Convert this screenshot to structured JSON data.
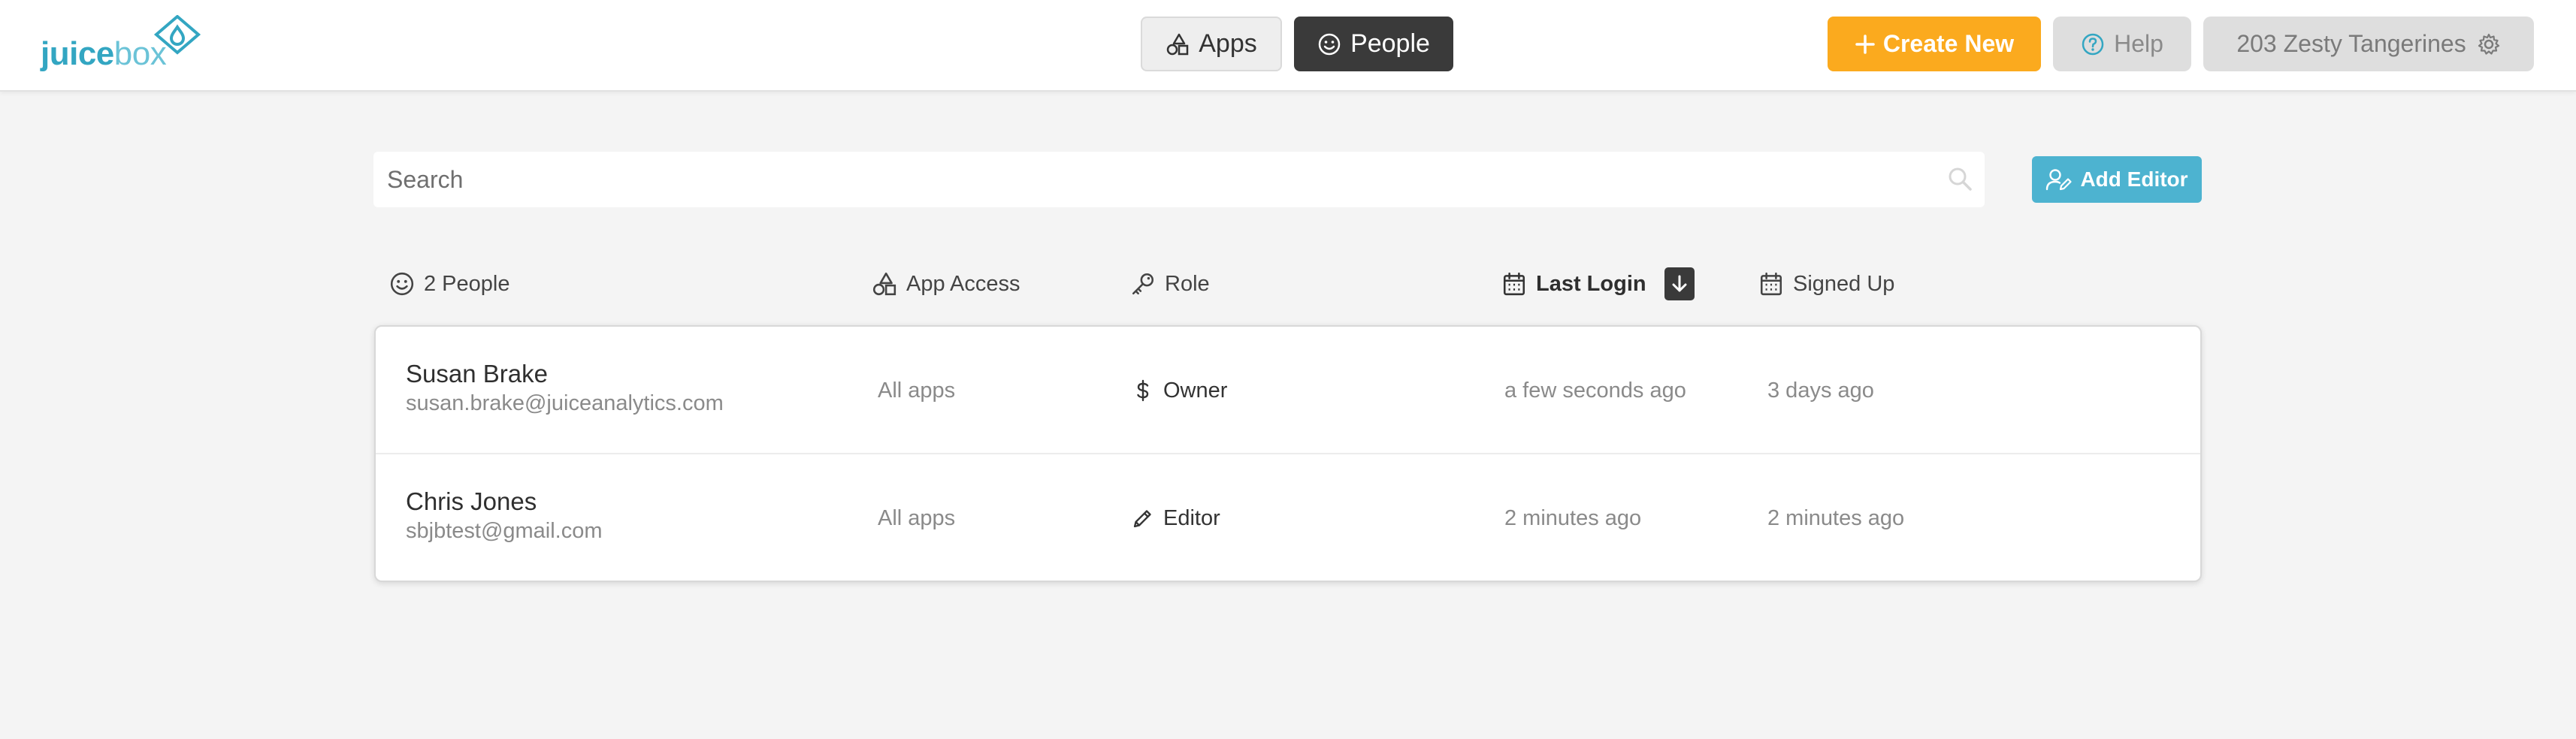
{
  "brand": {
    "part1": "juice",
    "part2": "box"
  },
  "nav": {
    "apps_label": "Apps",
    "people_label": "People"
  },
  "header": {
    "create_label": "Create New",
    "help_label": "Help",
    "team_label": "203 Zesty Tangerines"
  },
  "search": {
    "placeholder": "Search",
    "value": ""
  },
  "add_editor_label": "Add Editor",
  "columns": {
    "people": "2 People",
    "app_access": "App Access",
    "role": "Role",
    "last_login": "Last Login",
    "signed_up": "Signed Up"
  },
  "rows": [
    {
      "name": "Susan Brake",
      "email": "susan.brake@juiceanalytics.com",
      "access": "All apps",
      "role": "Owner",
      "role_icon": "dollar-icon",
      "last_login": "a few seconds ago",
      "signed_up": "3 days ago"
    },
    {
      "name": "Chris Jones",
      "email": "sbjbtest@gmail.com",
      "access": "All apps",
      "role": "Editor",
      "role_icon": "pencil-icon",
      "last_login": "2 minutes ago",
      "signed_up": "2 minutes ago"
    }
  ],
  "colors": {
    "brand": "#33a6c2",
    "create_button": "#fbaa1e",
    "add_editor_button": "#4db3d0",
    "active_nav": "#3a3a3a"
  }
}
